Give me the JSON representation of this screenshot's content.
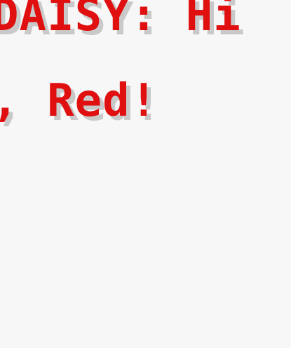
{
  "dialog": {
    "line1": "DAISY: Hi",
    "line2": ", Red!"
  },
  "colors": {
    "text": "#e01010",
    "shadow": "#c9c9c9",
    "background": "#f7f7f7"
  }
}
